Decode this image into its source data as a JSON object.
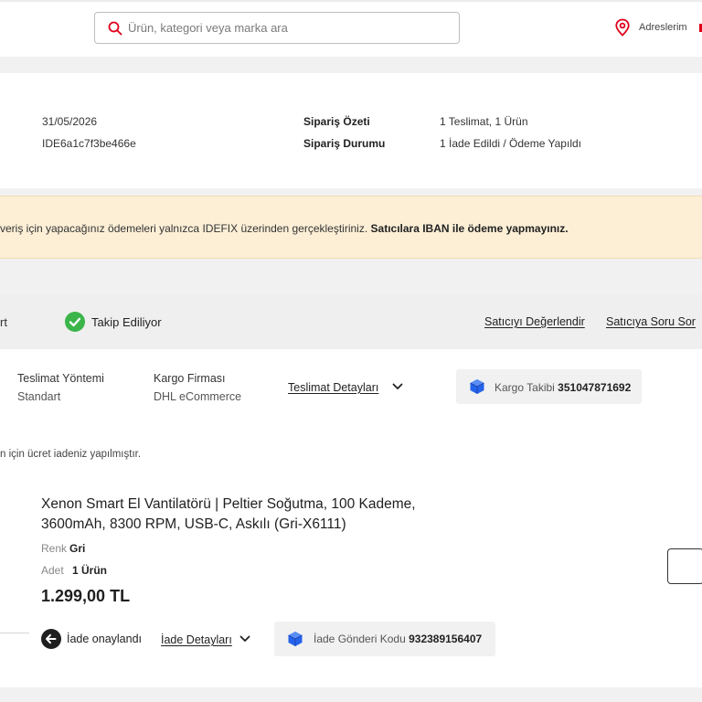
{
  "header": {
    "search_placeholder": "Ürün, kategori veya marka ara",
    "address_label": "Adreslerim"
  },
  "order": {
    "date": "31/05/2026",
    "order_id": "IDE6a1c7f3be466e",
    "summary_label": "Sipariş Özeti",
    "summary_value": "1 Teslimat, 1 Ürün",
    "status_label": "Sipariş Durumu",
    "status_value": "1 İade Edildi / Ödeme Yapıldı"
  },
  "warning": {
    "text": "veriş için yapacağınız ödemeleri yalnızca IDEFIX üzerinden gerçekleştiriniz. ",
    "bold": "Satıcılara IBAN ile ödeme yapmayınız."
  },
  "tracking": {
    "prefix": "rt",
    "status": "Takip Ediliyor",
    "rate_seller": "Satıcıyı Değerlendir",
    "ask_seller": "Satıcıya Soru Sor"
  },
  "shipment": {
    "method_label": "Teslimat Yöntemi",
    "method_value": "Standart",
    "carrier_label": "Kargo Firması",
    "carrier_value": "DHL eCommerce",
    "details_link": "Teslimat Detayları",
    "cargo_label": "Kargo Takibi",
    "cargo_code": "351047871692",
    "refund_note": "n için ücret iadeniz yapılmıştır."
  },
  "product": {
    "title": "Xenon Smart El Vantilatörü | Peltier Soğutma, 100 Kademe, 3600mAh, 8300 RPM, USB-C, Askılı (Gri-X6111)",
    "color_label": "Renk",
    "color_value": "Gri",
    "qty_label": "Adet",
    "qty_value": "1 Ürün",
    "price": "1.299,00 TL"
  },
  "return": {
    "status": "İade onaylandı",
    "details_link": "İade Detayları",
    "shipment_label": "İade Gönderi Kodu",
    "shipment_code": "932389156407"
  },
  "colors": {
    "accent_red": "#e0001b",
    "success_green": "#3bb54a",
    "warning_bg": "#fcefd6",
    "cargo_blue": "#2563eb"
  }
}
